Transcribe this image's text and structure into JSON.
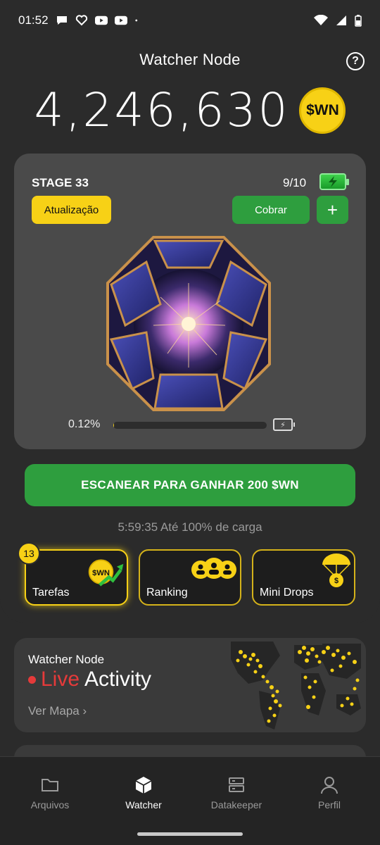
{
  "status_bar": {
    "time": "01:52",
    "left_icons": [
      "chat-bubble-icon",
      "heart-link-icon",
      "youtube-icon",
      "youtube-icon",
      "dot-icon"
    ],
    "right_icons": [
      "wifi-icon",
      "signal-icon",
      "battery-icon"
    ]
  },
  "header": {
    "title": "Watcher Node",
    "help_icon": "question-circle-icon",
    "balance": "4,246,630",
    "coin_label": "$WN"
  },
  "stage": {
    "label": "STAGE 33",
    "count": "9/10",
    "update_label": "Atualização",
    "collect_label": "Cobrar",
    "plus_label": "+",
    "progress_text": "0.12%",
    "progress_fraction": 0.0012
  },
  "scan": {
    "button_label": "ESCANEAR PARA GANHAR 200 $WN",
    "timer_text": "5:59:35 Até 100% de carga"
  },
  "features": {
    "tarefas": {
      "label": "Tarefas",
      "badge": "13",
      "coin_text": "$WN"
    },
    "ranking": {
      "label": "Ranking"
    },
    "drops": {
      "label": "Mini Drops",
      "coin_text": "$"
    }
  },
  "live": {
    "title": "Watcher Node",
    "live_word": "Live",
    "activity_word": "Activity",
    "link_text": "Ver Mapa",
    "link_chevron": "›"
  },
  "nav": {
    "items": [
      {
        "label": "Arquivos",
        "icon": "folder-icon"
      },
      {
        "label": "Watcher",
        "icon": "cube-icon"
      },
      {
        "label": "Datakeeper",
        "icon": "server-icon"
      },
      {
        "label": "Perfil",
        "icon": "user-icon"
      }
    ],
    "active_index": 1
  },
  "colors": {
    "accent_yellow": "#f7d116",
    "accent_green": "#2e9e3e",
    "live_red": "#e53a3a",
    "background": "#2b2b2b",
    "card": "#4a4a4a"
  }
}
